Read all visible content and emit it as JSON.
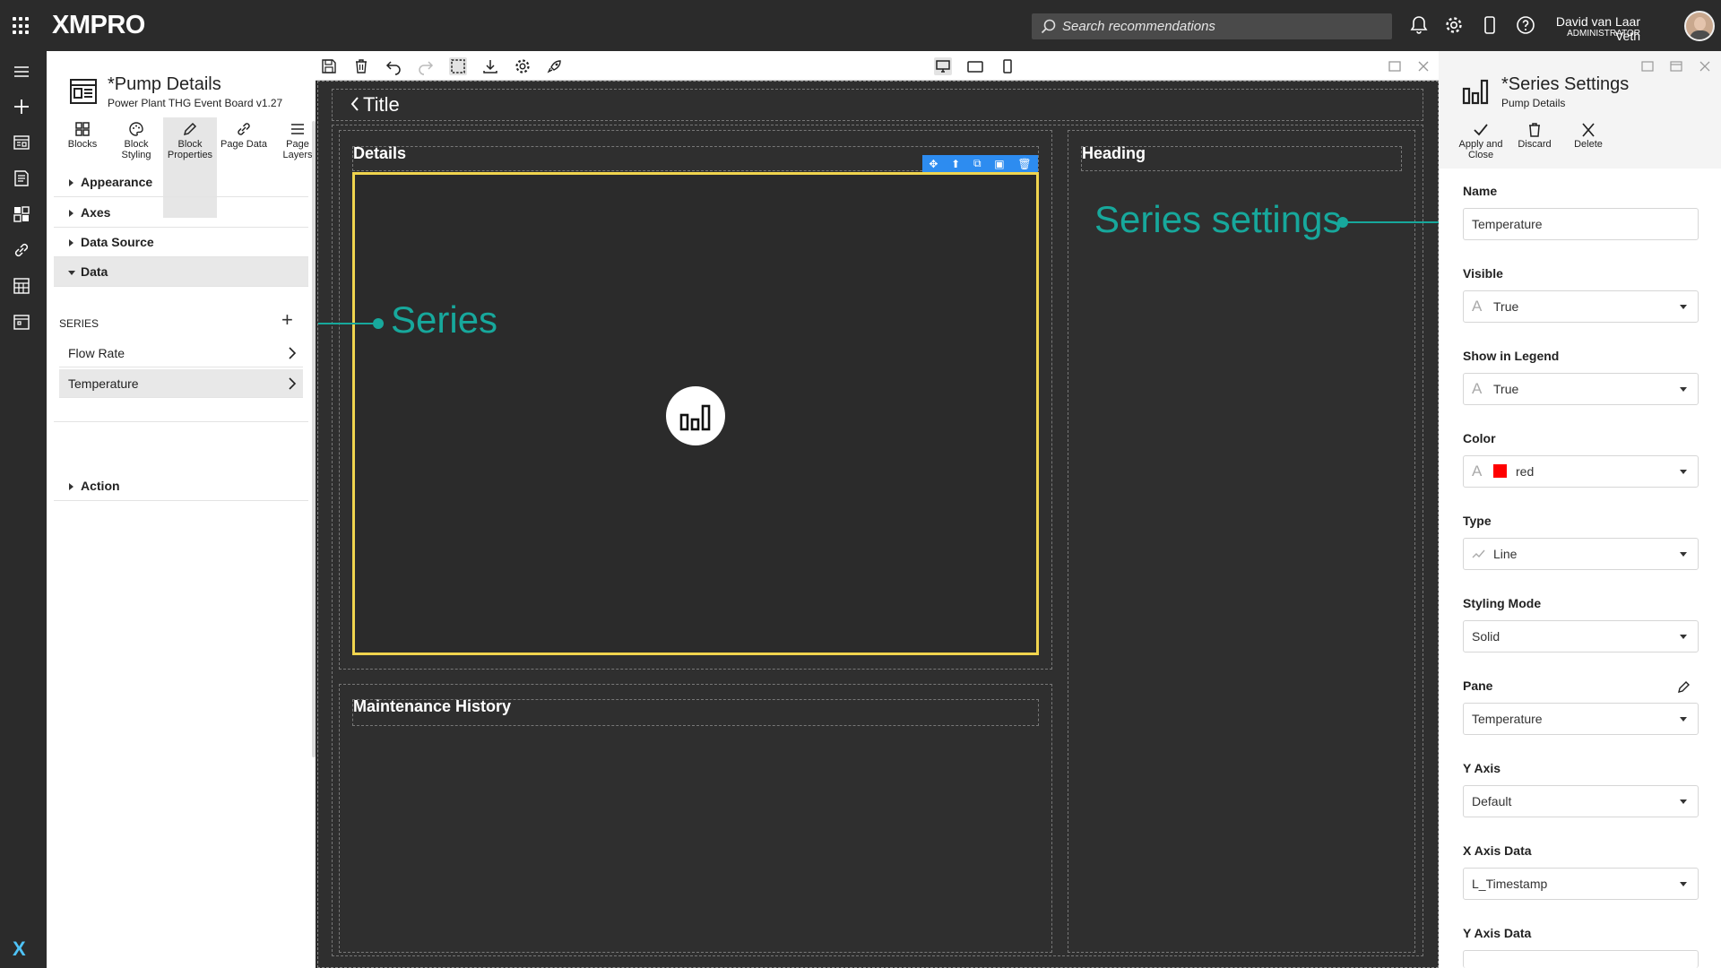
{
  "app": {
    "logo": "XMPRO",
    "search_placeholder": "Search recommendations",
    "user_name": "David van Laar Veth",
    "user_role": "ADMINISTRATOR"
  },
  "left_panel": {
    "page_title": "*Pump Details",
    "page_subtitle": "Power Plant THG Event Board v1.27",
    "tools": [
      {
        "label_1": "Blocks",
        "label_2": ""
      },
      {
        "label_1": "Block",
        "label_2": "Styling"
      },
      {
        "label_1": "Block",
        "label_2": "Properties"
      },
      {
        "label_1": "Page Data",
        "label_2": ""
      },
      {
        "label_1": "Page",
        "label_2": "Layers"
      }
    ],
    "sections": {
      "appearance": "Appearance",
      "axes": "Axes",
      "data_source": "Data Source",
      "data": "Data",
      "action": "Action"
    },
    "series_label": "SERIES",
    "series_items": [
      "Flow Rate",
      "Temperature"
    ]
  },
  "canvas": {
    "title": "Title",
    "details_heading": "Details",
    "heading": "Heading",
    "maintenance_heading": "Maintenance History"
  },
  "annotations": {
    "series": "Series",
    "series_settings": "Series settings",
    "color": "#17a89c"
  },
  "right_panel": {
    "title": "*Series Settings",
    "subtitle": "Pump Details",
    "actions": [
      {
        "label_1": "Apply and",
        "label_2": "Close"
      },
      {
        "label_1": "Discard",
        "label_2": ""
      },
      {
        "label_1": "Delete",
        "label_2": ""
      }
    ],
    "fields": {
      "name_label": "Name",
      "name_value": "Temperature",
      "visible_label": "Visible",
      "visible_value": "True",
      "legend_label": "Show in Legend",
      "legend_value": "True",
      "color_label": "Color",
      "color_value": "red",
      "type_label": "Type",
      "type_value": "Line",
      "styling_label": "Styling Mode",
      "styling_value": "Solid",
      "pane_label": "Pane",
      "pane_value": "Temperature",
      "yaxis_label": "Y Axis",
      "yaxis_value": "Default",
      "xdata_label": "X Axis Data",
      "xdata_value": "L_Timestamp",
      "ydata_label": "Y Axis Data"
    }
  },
  "colors": {
    "selection_border": "#f0d44e",
    "block_toolbar": "#2d8cf0",
    "swatch_red": "#ff0000"
  }
}
